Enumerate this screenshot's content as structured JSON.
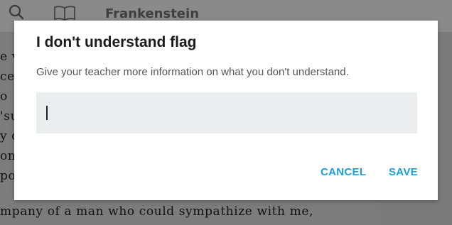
{
  "header": {
    "book_title": "Frankenstein"
  },
  "page": {
    "lines": [
      "e v",
      "ce",
      "o",
      "'su",
      "y d",
      "on.",
      "po",
      "mpany of a man who could sympathize with me,"
    ]
  },
  "dialog": {
    "title": "I don't understand flag",
    "description": "Give your teacher more information on what you don't understand.",
    "input_value": "",
    "cancel_label": "CANCEL",
    "save_label": "SAVE"
  },
  "colors": {
    "accent": "#1a9fdb",
    "overlay": "#7b7b7b",
    "input_bg": "#ebedef"
  }
}
